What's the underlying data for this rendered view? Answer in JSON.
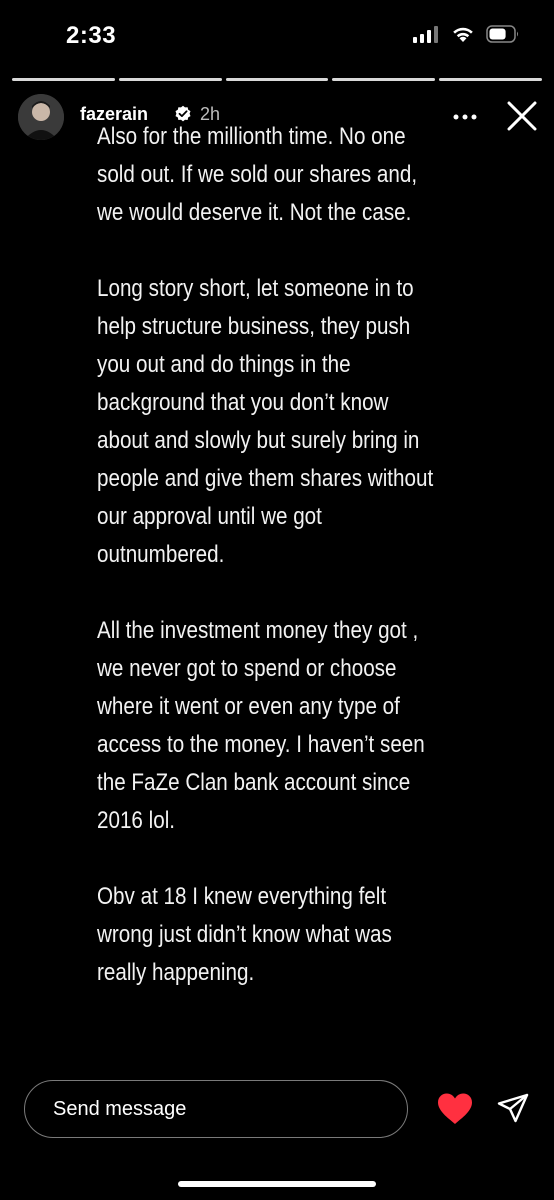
{
  "status_bar": {
    "time": "2:33",
    "battery_level": 0.7
  },
  "story": {
    "total_segments": 5,
    "current_segment": 5,
    "username": "fazerain",
    "verified": true,
    "time_ago": "2h",
    "paragraphs": [
      "Also for the millionth time. No one\nsold out. If we sold our shares and,\nwe would deserve it. Not the case.",
      "Long story short, let someone in to\nhelp structure business, they push\nyou out and do things in the\nbackground that you don’t know\nabout and slowly but surely bring in\npeople and give them shares without\nour approval until we got\noutnumbered.",
      "All the investment money they got ,\nwe never got to spend or choose\nwhere it went or even any type of\naccess to the money. I haven’t seen\nthe FaZe Clan bank account since\n2016 lol.",
      "Obv at 18 I knew everything felt\nwrong just didn’t know what was\nreally happening."
    ]
  },
  "footer": {
    "message_placeholder": "Send message"
  },
  "icons": {
    "signal": "cellular-signal-icon",
    "wifi": "wifi-icon",
    "battery": "battery-icon",
    "verified": "verified-badge-icon",
    "more": "more-options-icon",
    "close": "close-icon",
    "like": "heart-icon",
    "send": "paper-plane-icon"
  },
  "colors": {
    "background": "#000000",
    "text": "#ffffff",
    "like": "#ff3040",
    "verified_badge": "#ffffff"
  }
}
